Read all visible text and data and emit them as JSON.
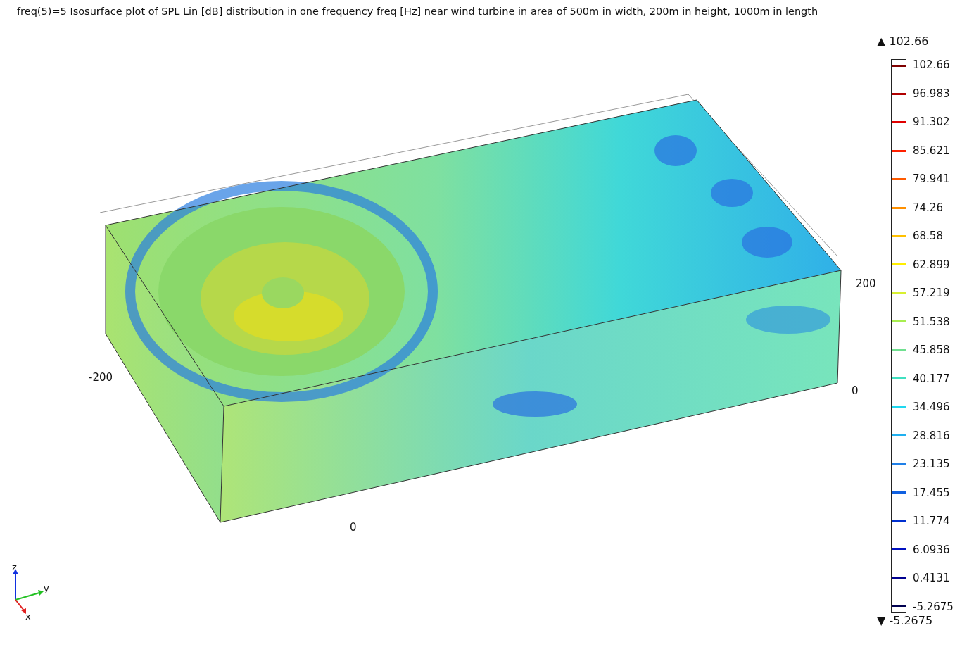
{
  "title": "freq(5)=5  Isosurface plot of SPL Lin [dB] distribution in one frequency freq [Hz] near wind turbine in area of 500m in width, 200m in height, 1000m in length",
  "axis_labels": [
    "200",
    "0",
    "-200",
    "0"
  ],
  "triad": {
    "z": "z",
    "y": "y",
    "x": "x"
  },
  "legend": {
    "max": "▲ 102.66",
    "min": "▼ -5.2675",
    "items": [
      {
        "label": "102.66",
        "color": "#7f0000"
      },
      {
        "label": "96.983",
        "color": "#b00000"
      },
      {
        "label": "91.302",
        "color": "#e00000"
      },
      {
        "label": "85.621",
        "color": "#ff2000"
      },
      {
        "label": "79.941",
        "color": "#ff5a00"
      },
      {
        "label": "74.26",
        "color": "#ff9000"
      },
      {
        "label": "68.58",
        "color": "#ffc000"
      },
      {
        "label": "62.899",
        "color": "#ffee00"
      },
      {
        "label": "57.219",
        "color": "#d8f030"
      },
      {
        "label": "51.538",
        "color": "#a8ee50"
      },
      {
        "label": "45.858",
        "color": "#70e090"
      },
      {
        "label": "40.177",
        "color": "#40e0c0"
      },
      {
        "label": "34.496",
        "color": "#20d8f0"
      },
      {
        "label": "28.816",
        "color": "#20b0f0"
      },
      {
        "label": "23.135",
        "color": "#2080e8"
      },
      {
        "label": "17.455",
        "color": "#1060e0"
      },
      {
        "label": "11.774",
        "color": "#0030d0"
      },
      {
        "label": "6.0936",
        "color": "#0010c0"
      },
      {
        "label": "0.4131",
        "color": "#000090"
      },
      {
        "label": "-5.2675",
        "color": "#000050"
      }
    ]
  }
}
